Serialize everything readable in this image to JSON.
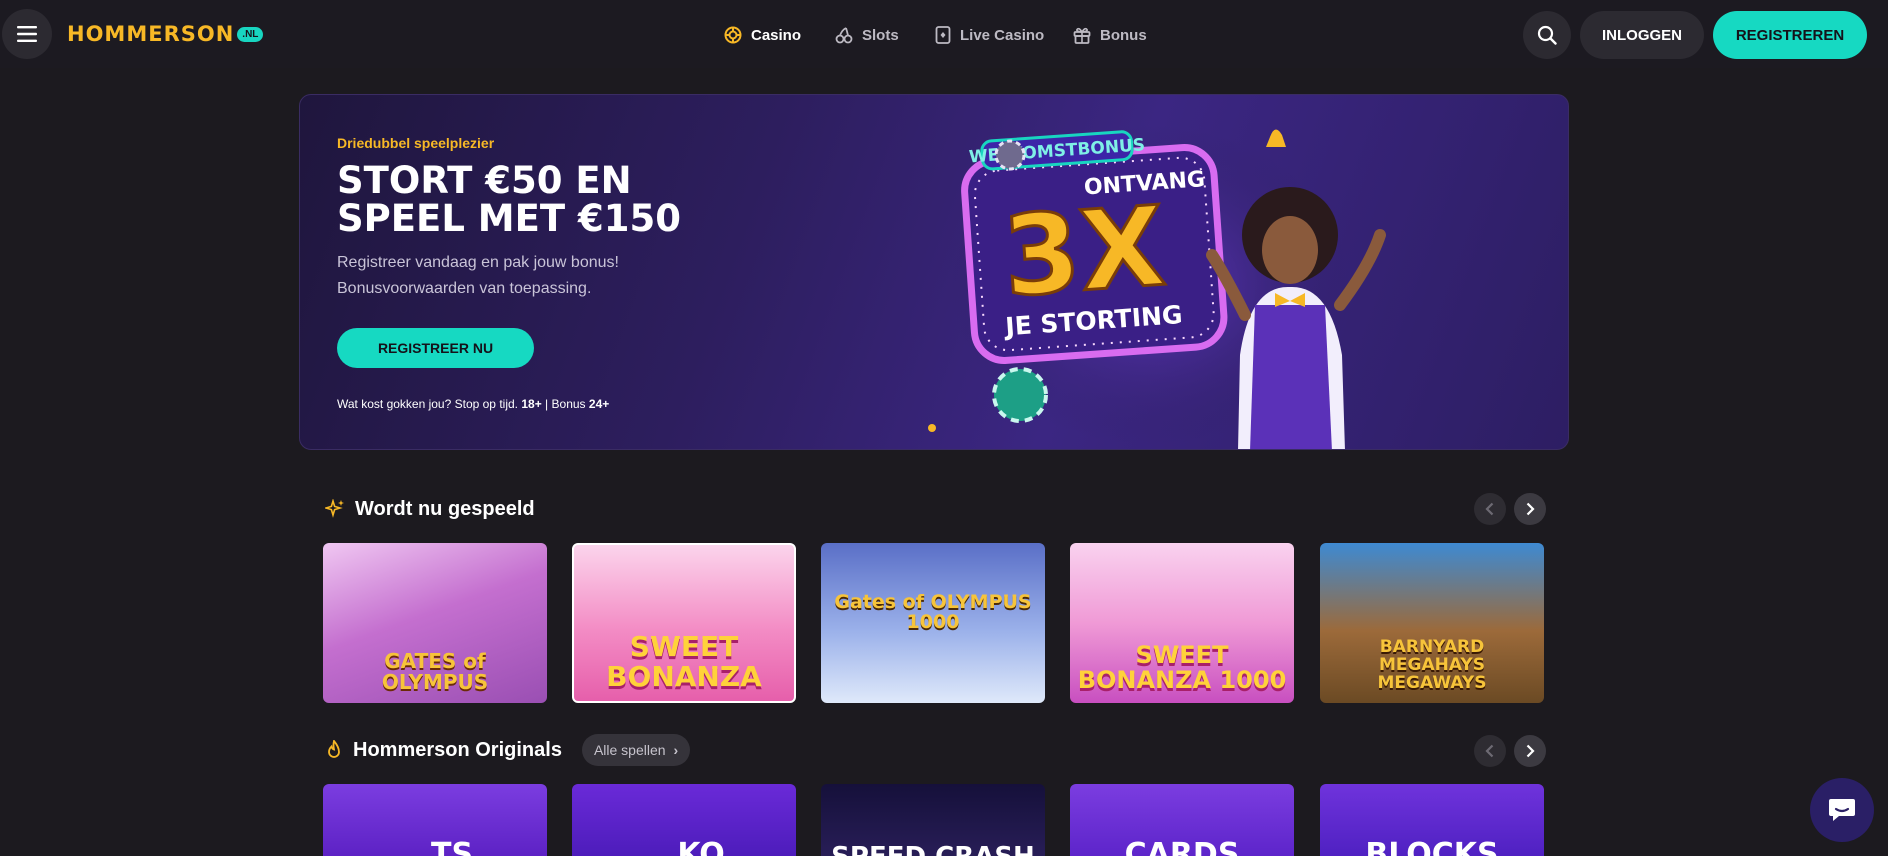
{
  "header": {
    "logo_text": "HOMMERSON",
    "logo_badge": ".NL",
    "nav": [
      {
        "label": "Casino",
        "icon": "casino-chip-icon",
        "active": true
      },
      {
        "label": "Slots",
        "icon": "cherries-icon",
        "active": false
      },
      {
        "label": "Live Casino",
        "icon": "playing-card-icon",
        "active": false
      },
      {
        "label": "Bonus",
        "icon": "gift-icon",
        "active": false
      }
    ],
    "login_label": "INLOGGEN",
    "register_label": "REGISTREREN"
  },
  "hero": {
    "eyebrow": "Driedubbel speelplezier",
    "title_line1": "STORT €50 EN",
    "title_line2": "SPEEL MET €150",
    "subtitle_line1": "Registreer vandaag en pak jouw bonus!",
    "subtitle_line2": "Bonusvoorwaarden van toepassing.",
    "cta_label": "REGISTREER NU",
    "disclaimer_text": "Wat kost gokken jou? Stop op tijd.",
    "disclaimer_age1": "18+",
    "disclaimer_sep": "|",
    "disclaimer_bonus": "Bonus",
    "disclaimer_age2": "24+",
    "art_banner": "WELKOMSTBONUS",
    "art_top": "ONTVANG",
    "art_big": "3X",
    "art_bottom": "JE STORTING",
    "slide_count": 1
  },
  "sections": {
    "popular": {
      "title": "Wordt nu gespeeld",
      "games": [
        {
          "name": "GATES of OLYMPUS",
          "bg": "#c88bd0"
        },
        {
          "name": "SWEET BONANZA",
          "bg": "#f596c2"
        },
        {
          "name": "Gates of OLYMPUS 1000",
          "bg": "#8fa3e0"
        },
        {
          "name": "SWEET BONANZA 1000",
          "bg": "#e68ed2"
        },
        {
          "name": "BARNYARD MEGAHAYS MEGAWAYS",
          "bg": "#3f8bd1"
        }
      ]
    },
    "originals": {
      "title": "Hommerson Originals",
      "all_label": "Alle spellen",
      "games": [
        {
          "name": "...TS",
          "bg": "#6b2ad6"
        },
        {
          "name": "...KO",
          "bg": "#5a24cf"
        },
        {
          "name": "SPEED CRASH",
          "bg": "#1e1746"
        },
        {
          "name": "CARDS",
          "bg": "#6a2cd8"
        },
        {
          "name": "BLOCKS",
          "bg": "#5c2bd4"
        }
      ]
    }
  },
  "colors": {
    "accent": "#16d9c2",
    "brand_gold": "#f7b826",
    "background": "#1c1a1f"
  }
}
